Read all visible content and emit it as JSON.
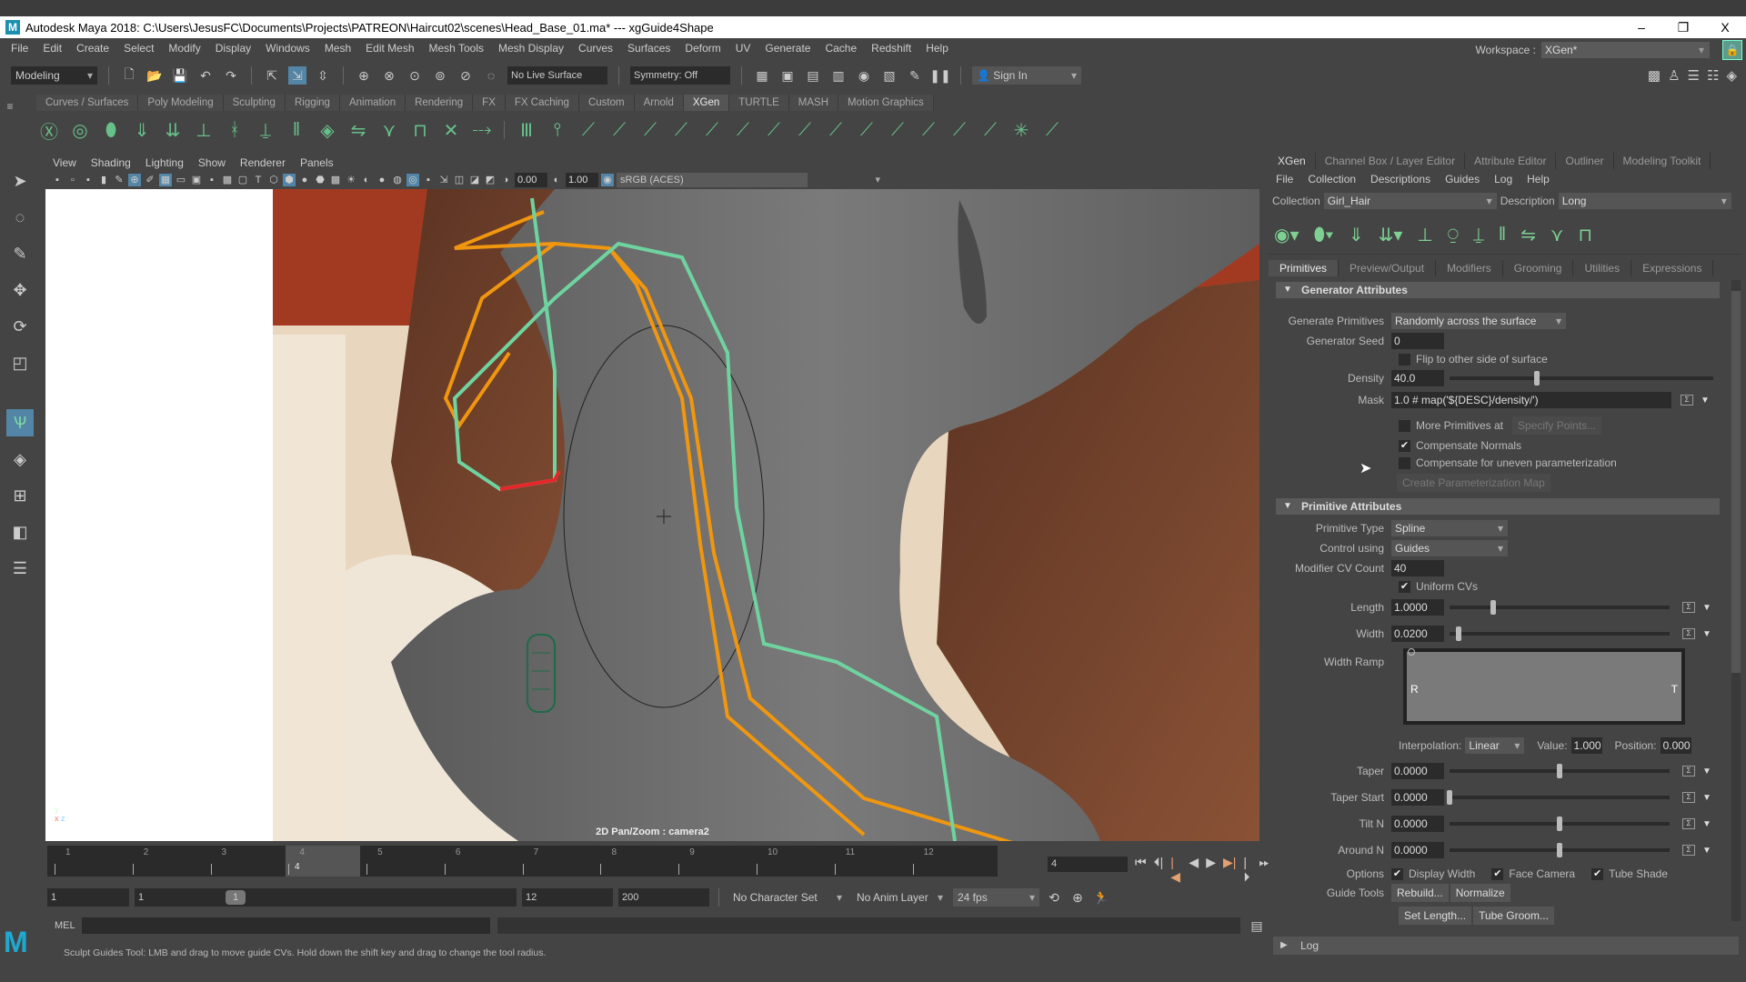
{
  "window": {
    "title": "Autodesk Maya 2018: C:\\Users\\JesusFC\\Documents\\Projects\\PATREON\\Haircut02\\scenes\\Head_Base_01.ma*  ---  xgGuide4Shape",
    "controls": {
      "minimize": "–",
      "restore": "❐",
      "close": "X"
    }
  },
  "menubar": [
    "File",
    "Edit",
    "Create",
    "Select",
    "Modify",
    "Display",
    "Windows",
    "Mesh",
    "Edit Mesh",
    "Mesh Tools",
    "Mesh Display",
    "Curves",
    "Surfaces",
    "Deform",
    "UV",
    "Generate",
    "Cache",
    "Redshift",
    "Help"
  ],
  "workspace": {
    "label": "Workspace :",
    "value": "XGen*"
  },
  "statusline": {
    "mode": "Modeling",
    "live_surface": "No Live Surface",
    "symmetry": "Symmetry: Off",
    "sign_in": "Sign In"
  },
  "shelf": {
    "tabs": [
      "Curves / Surfaces",
      "Poly Modeling",
      "Sculpting",
      "Rigging",
      "Animation",
      "Rendering",
      "FX",
      "FX Caching",
      "Custom",
      "Arnold",
      "XGen",
      "TURTLE",
      "MASH",
      "Motion Graphics"
    ],
    "active_tab": "XGen"
  },
  "viewport": {
    "menu": [
      "View",
      "Shading",
      "Lighting",
      "Show",
      "Renderer",
      "Panels"
    ],
    "exposure": "0.00",
    "gamma": "1.00",
    "color_space": "sRGB (ACES)",
    "camera_label": "2D Pan/Zoom : camera2",
    "axis_x": "x",
    "axis_y": "y",
    "axis_z": "z",
    "guide_colors": {
      "orange": "#f0960f",
      "green": "#6fd3a0",
      "red": "#e8262a"
    }
  },
  "timeline": {
    "ticks": [
      "1",
      "2",
      "3",
      "4",
      "5",
      "6",
      "7",
      "8",
      "9",
      "10",
      "11",
      "12"
    ],
    "current_frame": "4",
    "current_frame_field": "4",
    "range_start": "1",
    "anim_start": "1",
    "range_slider_label": "1",
    "range_end": "12",
    "anim_end": "200",
    "character_set": "No Character Set",
    "anim_layer": "No Anim Layer",
    "fps": "24 fps"
  },
  "command_line": {
    "lang": "MEL"
  },
  "help_line": "Sculpt Guides Tool: LMB and drag to move guide CVs. Hold down the shift key and drag to change the tool radius.",
  "xgen": {
    "tabs": [
      "XGen",
      "Channel Box / Layer Editor",
      "Attribute Editor",
      "Outliner",
      "Modeling Toolkit"
    ],
    "active_tab": "XGen",
    "menu": [
      "File",
      "Collection",
      "Descriptions",
      "Guides",
      "Log",
      "Help"
    ],
    "collection_label": "Collection",
    "collection": "Girl_Hair",
    "description_label": "Description",
    "description": "Long",
    "subtabs": [
      "Primitives",
      "Preview/Output",
      "Modifiers",
      "Grooming",
      "Utilities",
      "Expressions"
    ],
    "active_subtab": "Primitives",
    "generator": {
      "title": "Generator Attributes",
      "generate_primitives_label": "Generate Primitives",
      "generate_primitives": "Randomly across the surface",
      "seed_label": "Generator Seed",
      "seed": "0",
      "flip_label": "Flip to other side of surface",
      "flip": false,
      "density_label": "Density",
      "density": "40.0",
      "density_slider": 0.33,
      "mask_label": "Mask",
      "mask": "1.0 # map('${DESC}/density/')",
      "more_primitives_label": "More Primitives at",
      "more_primitives": false,
      "specify_points": "Specify Points...",
      "compensate_normals_label": "Compensate Normals",
      "compensate_normals": true,
      "compensate_uneven_label": "Compensate for uneven parameterization",
      "compensate_uneven": false,
      "create_param_map": "Create Parameterization Map"
    },
    "primitive": {
      "title": "Primitive Attributes",
      "type_label": "Primitive Type",
      "type": "Spline",
      "control_label": "Control using",
      "control": "Guides",
      "cv_count_label": "Modifier CV Count",
      "cv_count": "40",
      "uniform_cvs_label": "Uniform CVs",
      "uniform_cvs": true,
      "length_label": "Length",
      "length": "1.0000",
      "length_slider": 0.2,
      "width_label": "Width",
      "width": "0.0200",
      "width_slider": 0.04,
      "width_ramp_label": "Width Ramp",
      "ramp_root": "R",
      "ramp_tip": "T",
      "interp_label": "Interpolation:",
      "interp": "Linear",
      "value_label": "Value:",
      "value": "1.000",
      "position_label": "Position:",
      "position": "0.000",
      "taper_label": "Taper",
      "taper": "0.0000",
      "taper_slider": 0.5,
      "taper_start_label": "Taper Start",
      "taper_start": "0.0000",
      "taper_start_slider": 0.0,
      "tilt_label": "Tilt N",
      "tilt": "0.0000",
      "tilt_slider": 0.5,
      "around_label": "Around N",
      "around": "0.0000",
      "around_slider": 0.5,
      "options_label": "Options",
      "display_width_label": "Display Width",
      "display_width": true,
      "face_camera_label": "Face Camera",
      "face_camera": true,
      "tube_shade_label": "Tube Shade",
      "tube_shade": true,
      "guide_tools_label": "Guide Tools",
      "rebuild": "Rebuild...",
      "normalize": "Normalize",
      "set_length": "Set Length...",
      "tube_groom": "Tube Groom..."
    },
    "log": "Log"
  }
}
